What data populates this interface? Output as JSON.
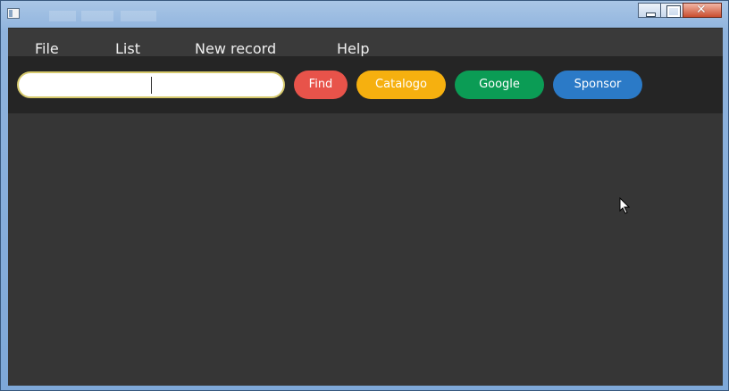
{
  "menu": {
    "file": "File",
    "list": "List",
    "new_record": "New record",
    "help": "Help"
  },
  "search": {
    "value": "",
    "placeholder": ""
  },
  "buttons": {
    "find": "Find",
    "catalogo": "Catalogo",
    "google": "Google",
    "sponsor": "Sponsor"
  },
  "colors": {
    "find": "#e8534a",
    "catalogo": "#f6b00f",
    "google": "#0b9c55",
    "sponsor": "#2b7ac7"
  },
  "icons": {
    "app": "app-window-icon",
    "minimize": "minimize-icon",
    "maximize": "maximize-icon",
    "close": "close-icon",
    "cursor": "mouse-pointer-icon"
  }
}
